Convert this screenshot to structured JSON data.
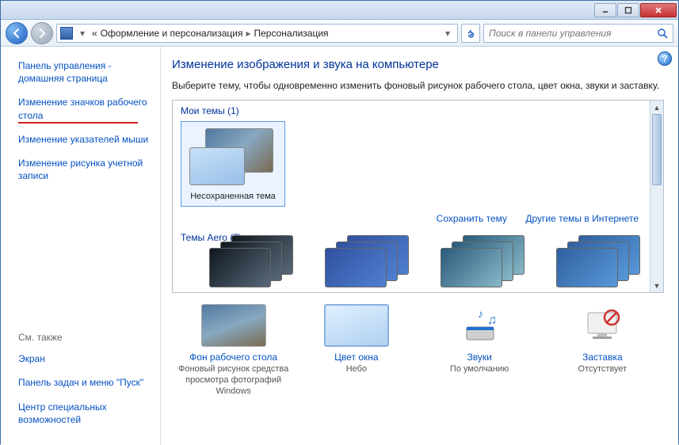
{
  "window": {
    "minimize": "minimize",
    "maximize": "maximize",
    "close": "close"
  },
  "nav": {
    "back_icon": "back",
    "fwd_icon": "forward",
    "bread_prefix": "«",
    "bread_seg1": "Оформление и персонализация",
    "bread_seg2": "Персонализация",
    "search_placeholder": "Поиск в панели управления"
  },
  "side": {
    "home": "Панель управления - домашняя страница",
    "link_icons": "Изменение значков рабочего стола",
    "link_cursors": "Изменение указателей мыши",
    "link_account_pic": "Изменение рисунка учетной записи",
    "also_label": "См. также",
    "link_screen": "Экран",
    "link_taskbar": "Панель задач и меню \"Пуск\"",
    "link_ease": "Центр специальных возможностей"
  },
  "main": {
    "heading": "Изменение изображения и звука на компьютере",
    "desc": "Выберите тему, чтобы одновременно изменить фоновый рисунок рабочего стола, цвет окна, звуки и заставку.",
    "my_themes_label": "Мои темы (1)",
    "unsaved_theme": "Несохраненная тема",
    "save_theme": "Сохранить тему",
    "more_online": "Другие темы в Интернете",
    "aero_label": "Темы Aero (7)"
  },
  "bottom": {
    "bg": {
      "title": "Фон рабочего стола",
      "sub": "Фоновый рисунок средства просмотра фотографий Windows"
    },
    "color": {
      "title": "Цвет окна",
      "sub": "Небо"
    },
    "sounds": {
      "title": "Звуки",
      "sub": "По умолчанию"
    },
    "saver": {
      "title": "Заставка",
      "sub": "Отсутствует"
    }
  }
}
